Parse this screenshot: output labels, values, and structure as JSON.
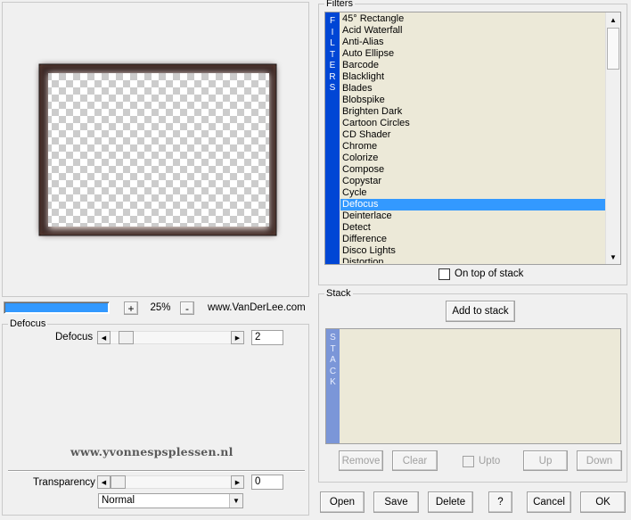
{
  "preview": {
    "zoom_minus_label": "-",
    "zoom_plus_label": "+",
    "zoom_value": "25%",
    "website": "www.VanDerLee.com",
    "progress": 1.0
  },
  "params_group": {
    "title": "Defocus",
    "defocus_label": "Defocus",
    "defocus_value": "2",
    "defocus_level": 0.05,
    "watermark": "www.yvonnespsplessen.nl",
    "transparency_label": "Transparency",
    "transparency_value": "0",
    "transparency_level": 0.0,
    "blend_mode": "Normal"
  },
  "filters_group": {
    "title": "Filters",
    "bar_letters": [
      "F",
      "I",
      "L",
      "T",
      "E",
      "R",
      "S"
    ],
    "items": [
      "45° Rectangle",
      "Acid Waterfall",
      "Anti-Alias",
      "Auto Ellipse",
      "Barcode",
      "Blacklight",
      "Blades",
      "Blobspike",
      "Brighten Dark",
      "Cartoon Circles",
      "CD Shader",
      "Chrome",
      "Colorize",
      "Compose",
      "Copystar",
      "Cycle",
      "Defocus",
      "Deinterlace",
      "Detect",
      "Difference",
      "Disco Lights",
      "Distortion"
    ],
    "selected_index": 16,
    "on_top_label": "On top of stack"
  },
  "stack_group": {
    "title": "Stack",
    "add_label": "Add to stack",
    "bar_letters": [
      "S",
      "T",
      "A",
      "C",
      "K"
    ],
    "remove_label": "Remove",
    "clear_label": "Clear",
    "upto_label": "Upto",
    "up_label": "Up",
    "down_label": "Down"
  },
  "footer": {
    "open": "Open",
    "save": "Save",
    "delete": "Delete",
    "help": "?",
    "cancel": "Cancel",
    "ok": "OK"
  },
  "colors": {
    "filters_bar": "#0046d5",
    "stack_bar": "#7b96d8",
    "selection": "#3399ff",
    "progress": "#3399ff",
    "list_bg": "#ece9d8",
    "frame": "#5a3c32"
  }
}
